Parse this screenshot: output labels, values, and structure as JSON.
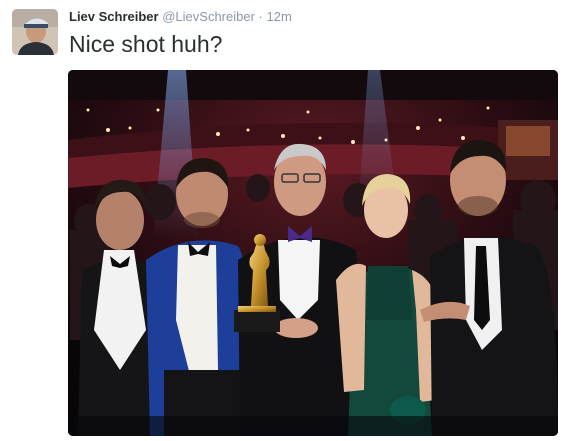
{
  "tweet": {
    "display_name": "Liev Schreiber",
    "handle": "@LievSchreiber",
    "separator": "·",
    "timestamp": "12m",
    "text": "Nice shot huh?"
  },
  "photo": {
    "subject": "group-photo"
  }
}
